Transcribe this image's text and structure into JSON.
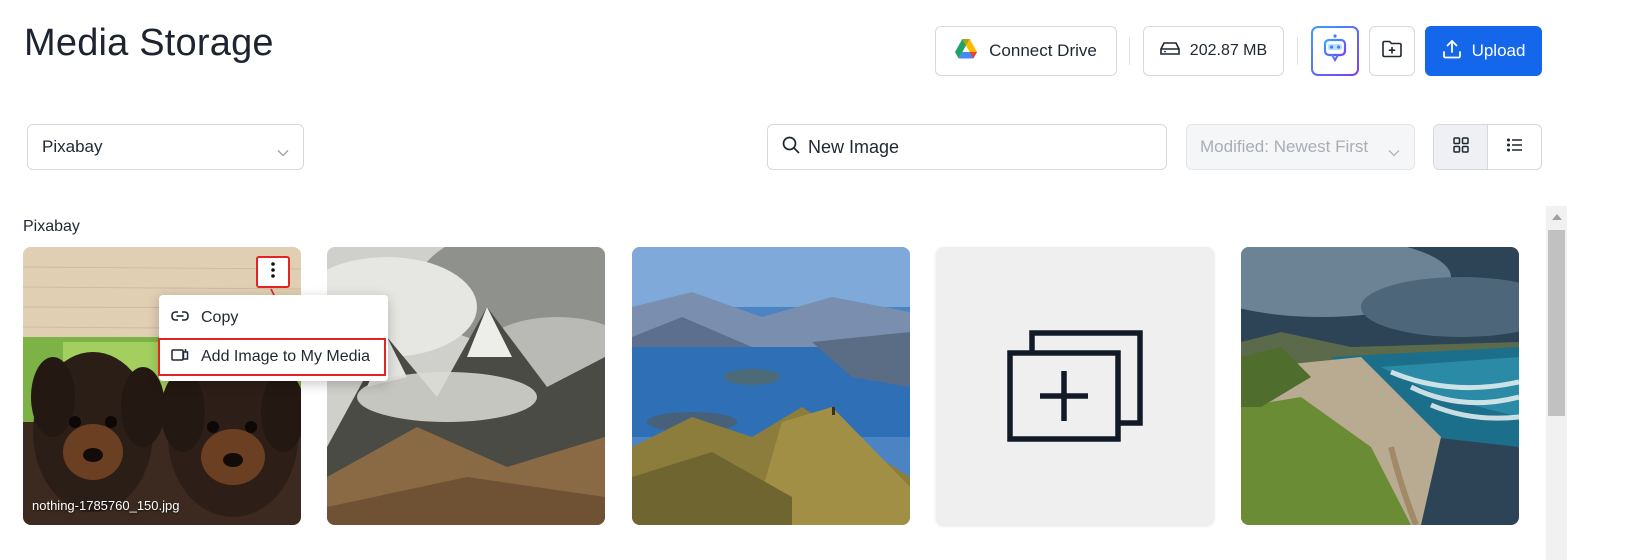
{
  "page": {
    "title": "Media Storage"
  },
  "header": {
    "connect_drive_label": "Connect Drive",
    "storage_used": "202.87 MB",
    "upload_label": "Upload"
  },
  "filters": {
    "source_value": "Pixabay",
    "search_value": "New Image",
    "sort_placeholder": "Modified: Newest First",
    "view_mode": "grid"
  },
  "section": {
    "label": "Pixabay"
  },
  "cards": [
    {
      "name": "nothing-1785760_150.jpg",
      "kind": "photo",
      "subject": "puppies"
    },
    {
      "name": "",
      "kind": "photo",
      "subject": "mountains"
    },
    {
      "name": "",
      "kind": "photo",
      "subject": "lake"
    },
    {
      "name": "",
      "kind": "add-placeholder",
      "subject": "add-media-icon"
    },
    {
      "name": "",
      "kind": "photo",
      "subject": "coast"
    }
  ],
  "context_menu": {
    "items": [
      {
        "label": "Copy",
        "icon": "link-icon"
      },
      {
        "label": "Add Image to My Media",
        "icon": "add-to-media-icon"
      }
    ]
  },
  "colors": {
    "accent": "#1467ea",
    "highlight": "#e22424",
    "disabled_text": "#a9aeb5"
  }
}
